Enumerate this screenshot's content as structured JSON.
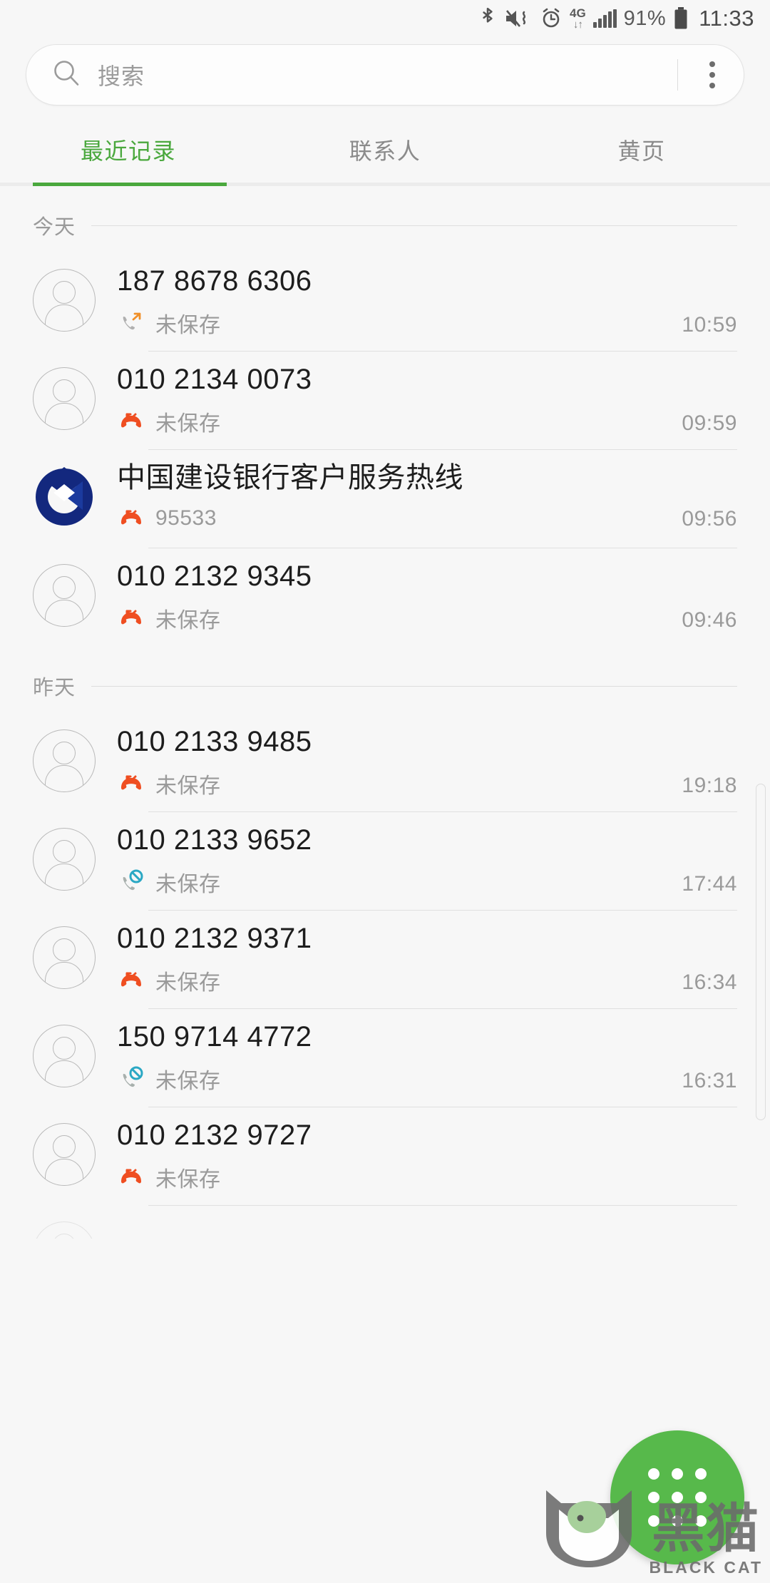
{
  "status_bar": {
    "icons": [
      "bluetooth-icon",
      "mute-vibrate-icon",
      "alarm-icon"
    ],
    "network_label": "4G",
    "network_arrows": "↓↑",
    "battery_percent": "91%",
    "clock": "11:33"
  },
  "search": {
    "placeholder": "搜索",
    "icon": "search-icon",
    "overflow_icon": "more-vertical-icon"
  },
  "tabs": [
    {
      "label": "最近记录",
      "active": true
    },
    {
      "label": "联系人",
      "active": false
    },
    {
      "label": "黄页",
      "active": false
    }
  ],
  "accent_color": "#4aa83d",
  "sections": [
    {
      "title": "今天",
      "rows": [
        {
          "name": "187 8678 6306",
          "subtitle": "未保存",
          "time": "10:59",
          "call_type": "outgoing",
          "avatar": "default-person-icon"
        },
        {
          "name": "010 2134 0073",
          "subtitle": "未保存",
          "time": "09:59",
          "call_type": "missed",
          "avatar": "default-person-icon"
        },
        {
          "name": "中国建设银行客户服务热线",
          "subtitle": "95533",
          "time": "09:56",
          "call_type": "missed",
          "avatar": "ccb-bank-logo"
        },
        {
          "name": "010 2132 9345",
          "subtitle": "未保存",
          "time": "09:46",
          "call_type": "missed",
          "avatar": "default-person-icon"
        }
      ]
    },
    {
      "title": "昨天",
      "rows": [
        {
          "name": "010 2133 9485",
          "subtitle": "未保存",
          "time": "19:18",
          "call_type": "missed",
          "avatar": "default-person-icon"
        },
        {
          "name": "010 2133 9652",
          "subtitle": "未保存",
          "time": "17:44",
          "call_type": "blocked",
          "avatar": "default-person-icon"
        },
        {
          "name": "010 2132 9371",
          "subtitle": "未保存",
          "time": "16:34",
          "call_type": "missed",
          "avatar": "default-person-icon"
        },
        {
          "name": "150 9714 4772",
          "subtitle": "未保存",
          "time": "16:31",
          "call_type": "blocked",
          "avatar": "default-person-icon"
        },
        {
          "name": "010 2132 9727",
          "subtitle": "未保存",
          "time": "",
          "call_type": "missed",
          "avatar": "default-person-icon"
        }
      ]
    }
  ],
  "fab": {
    "icon": "dialpad-icon",
    "color": "#57b94b"
  },
  "watermark": {
    "cn": "黑猫",
    "en": "BLACK CAT"
  }
}
